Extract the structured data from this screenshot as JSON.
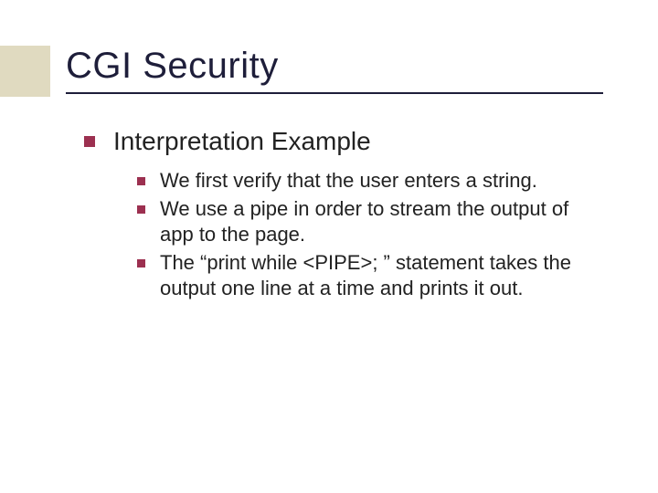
{
  "colors": {
    "accent": "#9c3050",
    "beige": "#e0dac0",
    "title": "#1e1e3a"
  },
  "title": "CGI Security",
  "heading": "Interpretation Example",
  "items": [
    "We first verify that the user enters a string.",
    "We use a pipe in order to stream the output of app to the page.",
    "The “print while <PIPE>; ” statement takes the output one line at a time and prints it out."
  ]
}
